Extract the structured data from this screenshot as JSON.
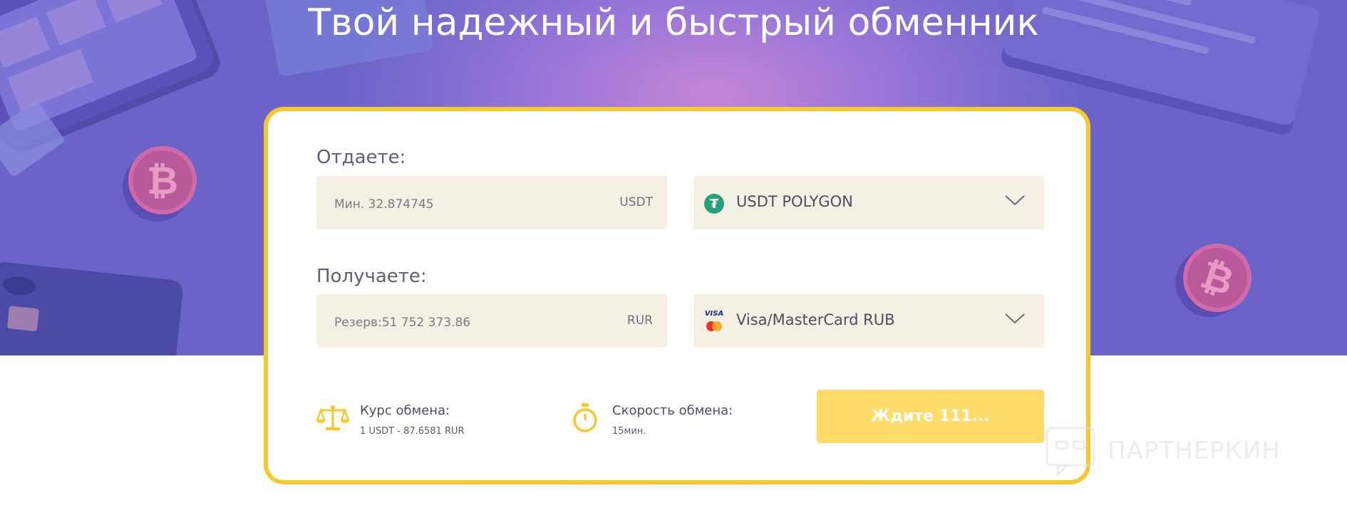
{
  "hero": {
    "title": "Твой надежный и быстрый обменник"
  },
  "exchange": {
    "give": {
      "label": "Отдаете:",
      "amount_placeholder": "Мин. 32.874745",
      "currency_code": "USDT",
      "selected_currency": "USDT POLYGON",
      "currency_icon": "tether-icon"
    },
    "get": {
      "label": "Получаете:",
      "amount_placeholder": "Резерв:51 752 373.86",
      "currency_code": "RUR",
      "selected_currency": "Visa/MasterCard RUB",
      "currency_icon": "visa-mastercard-icon"
    },
    "rate": {
      "title": "Курс обмена:",
      "value": "1 USDT - 87.6581 RUR",
      "icon": "scales-icon"
    },
    "speed": {
      "title": "Скорость обмена:",
      "value": "15мин.",
      "icon": "stopwatch-icon"
    },
    "submit_label": "Ждите 111..."
  },
  "watermark": {
    "text": "ПАРТНЕРКИН"
  },
  "colors": {
    "accent_yellow": "#f5c92b",
    "button_yellow": "#fedc69",
    "field_bg": "#f4f0e4",
    "hero_purple": "#6a64c9",
    "tether_green": "#26a17b"
  }
}
